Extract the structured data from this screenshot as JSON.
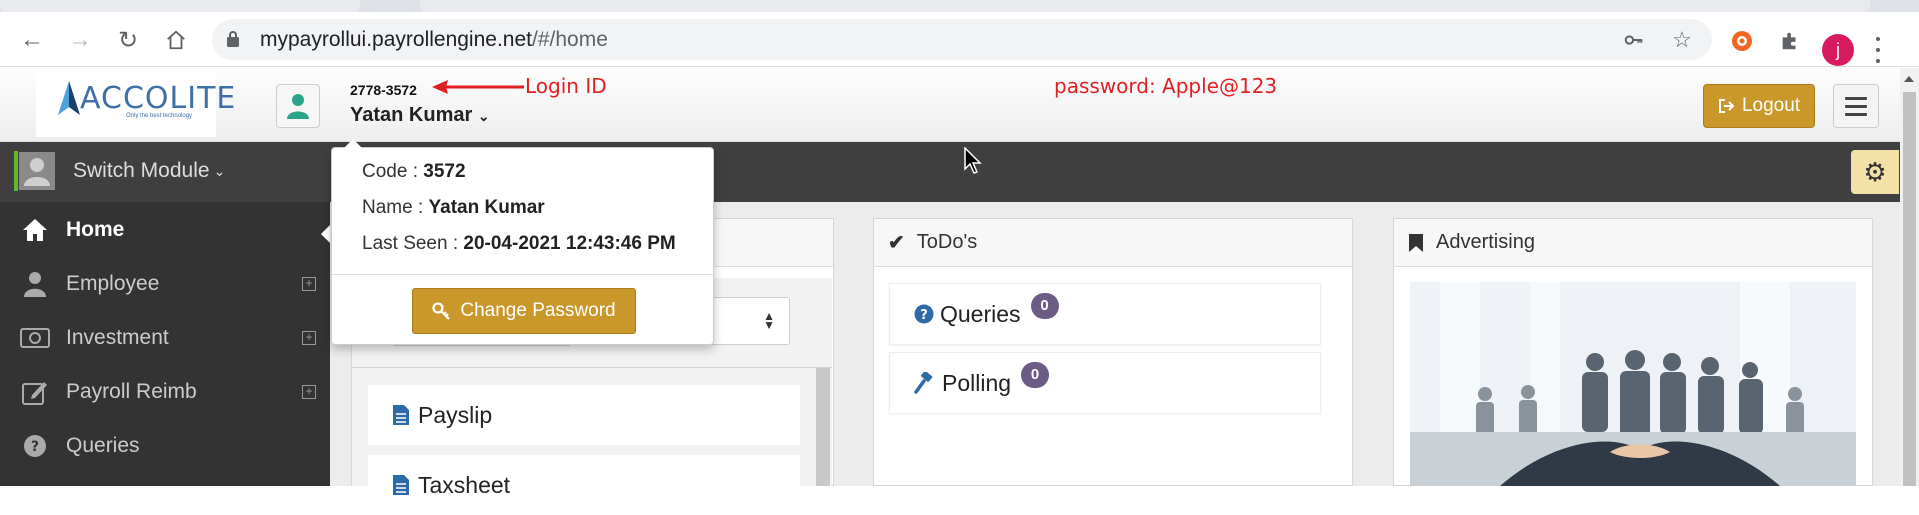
{
  "browser": {
    "url_host": "mypayrollui.payrollengine.net",
    "url_path": "/#/home",
    "profile_initial": "j"
  },
  "header": {
    "logo_text": "ACCOLITE",
    "logo_tagline": "Only the best technology",
    "login_id": "2778-3572",
    "user_name": "Yatan Kumar",
    "logout_label": "Logout"
  },
  "annotations": {
    "login_id_label": "Login ID",
    "password_note": "password: Apple@123",
    "color": "#e02020"
  },
  "sidebar": {
    "switch_module_label": "Switch Module",
    "items": [
      {
        "label": "Home",
        "icon": "home-icon",
        "expandable": false,
        "active": true
      },
      {
        "label": "Employee",
        "icon": "user-icon",
        "expandable": true,
        "active": false
      },
      {
        "label": "Investment",
        "icon": "money-icon",
        "expandable": true,
        "active": false
      },
      {
        "label": "Payroll Reimb",
        "icon": "edit-icon",
        "expandable": true,
        "active": false
      },
      {
        "label": "Queries",
        "icon": "question-icon",
        "expandable": false,
        "active": false
      }
    ]
  },
  "popup": {
    "code_label": "Code : ",
    "code_value": "3572",
    "name_label": "Name : ",
    "name_value": "Yatan Kumar",
    "last_seen_label": "Last Seen : ",
    "last_seen_value": "20-04-2021 12:43:46 PM",
    "change_password_label": "Change Password"
  },
  "panels": {
    "left": {
      "items": [
        {
          "label": "Payslip",
          "icon": "document-icon"
        },
        {
          "label": "Taxsheet",
          "icon": "document-icon"
        }
      ]
    },
    "todos": {
      "title": "ToDo's",
      "items": [
        {
          "label": "Queries",
          "count": "0",
          "icon": "question-icon"
        },
        {
          "label": "Polling",
          "count": "0",
          "icon": "gavel-icon"
        }
      ]
    },
    "advertising": {
      "title": "Advertising"
    }
  },
  "colors": {
    "accent_gold": "#c9972a",
    "sidebar_bg": "#333333",
    "badge": "#6b5b85",
    "active_green": "#5bbd2a"
  }
}
